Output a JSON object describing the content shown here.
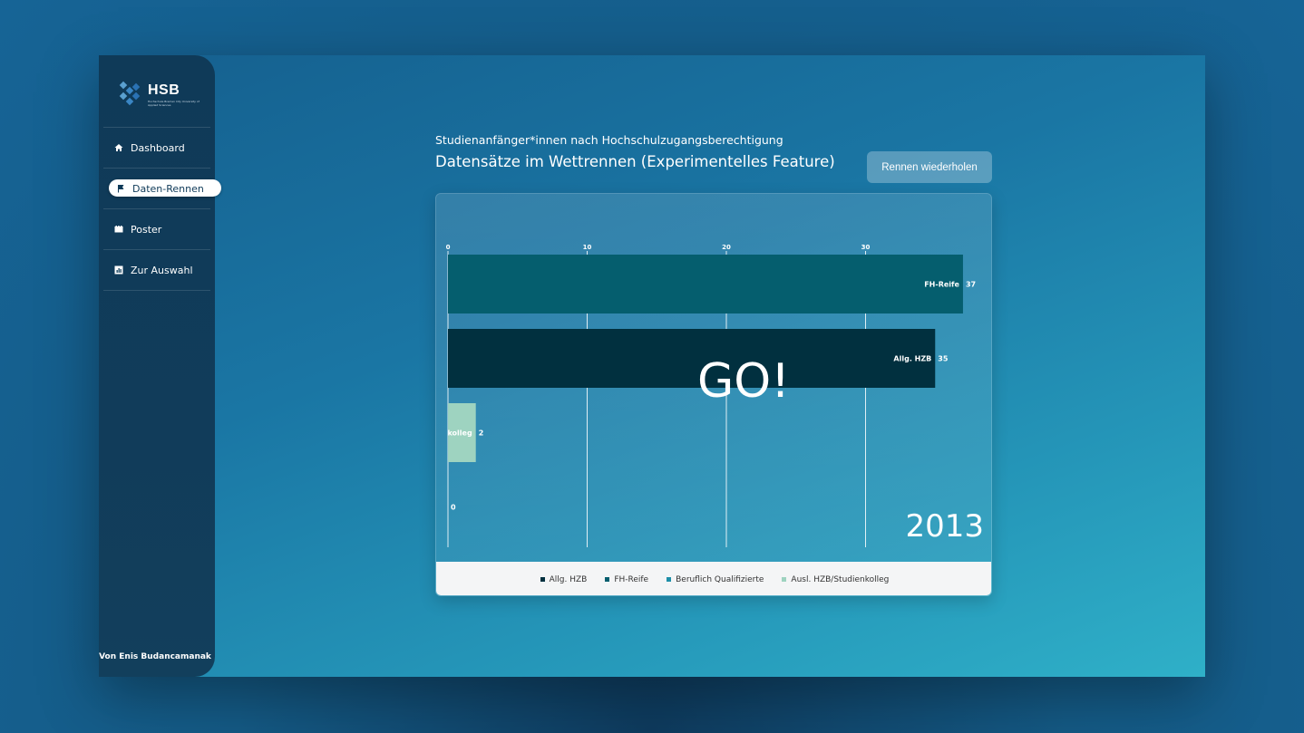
{
  "sidebar": {
    "logo": {
      "brand": "HSB",
      "sub": "Hochschule Bremen City University of Applied Sciences"
    },
    "items": [
      {
        "label": "Dashboard",
        "icon": "home-icon",
        "active": false
      },
      {
        "label": "Daten-Rennen",
        "icon": "flag-icon",
        "active": true
      },
      {
        "label": "Poster",
        "icon": "film-icon",
        "active": false
      },
      {
        "label": "Zur Auswahl",
        "icon": "chart-icon",
        "active": false
      }
    ],
    "author": "Von Enis Budancamanak"
  },
  "main": {
    "subtitle": "Studienanfänger*innen nach Hochschulzugangsberechtigung",
    "title": "Datensätze im Wettrennen (Experimentelles Feature)",
    "rerun_button": "Rennen wiederholen",
    "overlay": "GO!",
    "year": "2013"
  },
  "colors": {
    "Allg. HZB": "#01303f",
    "FH-Reife": "#055e6e",
    "Beruflich Qualifizierte": "#1e8fa8",
    "Ausl. HZB/Studienkolleg": "#9ed3c0"
  },
  "chart_data": {
    "type": "bar",
    "orientation": "horizontal",
    "year": "2013",
    "xlim": [
      0,
      40
    ],
    "xticks": [
      0,
      10,
      20,
      30
    ],
    "series": [
      {
        "name": "FH-Reife",
        "value": 37,
        "label": "FH-Reife"
      },
      {
        "name": "Allg. HZB",
        "value": 35,
        "label": "Allg. HZB"
      },
      {
        "name": "Ausl. HZB/Studienkolleg",
        "value": 2,
        "label": "kolleg"
      },
      {
        "name": "Beruflich Qualifizierte",
        "value": 0,
        "label": ""
      }
    ],
    "legend": [
      "Allg. HZB",
      "FH-Reife",
      "Beruflich Qualifizierte",
      "Ausl. HZB/Studienkolleg"
    ],
    "legend_position": "bottom",
    "grid": true
  }
}
